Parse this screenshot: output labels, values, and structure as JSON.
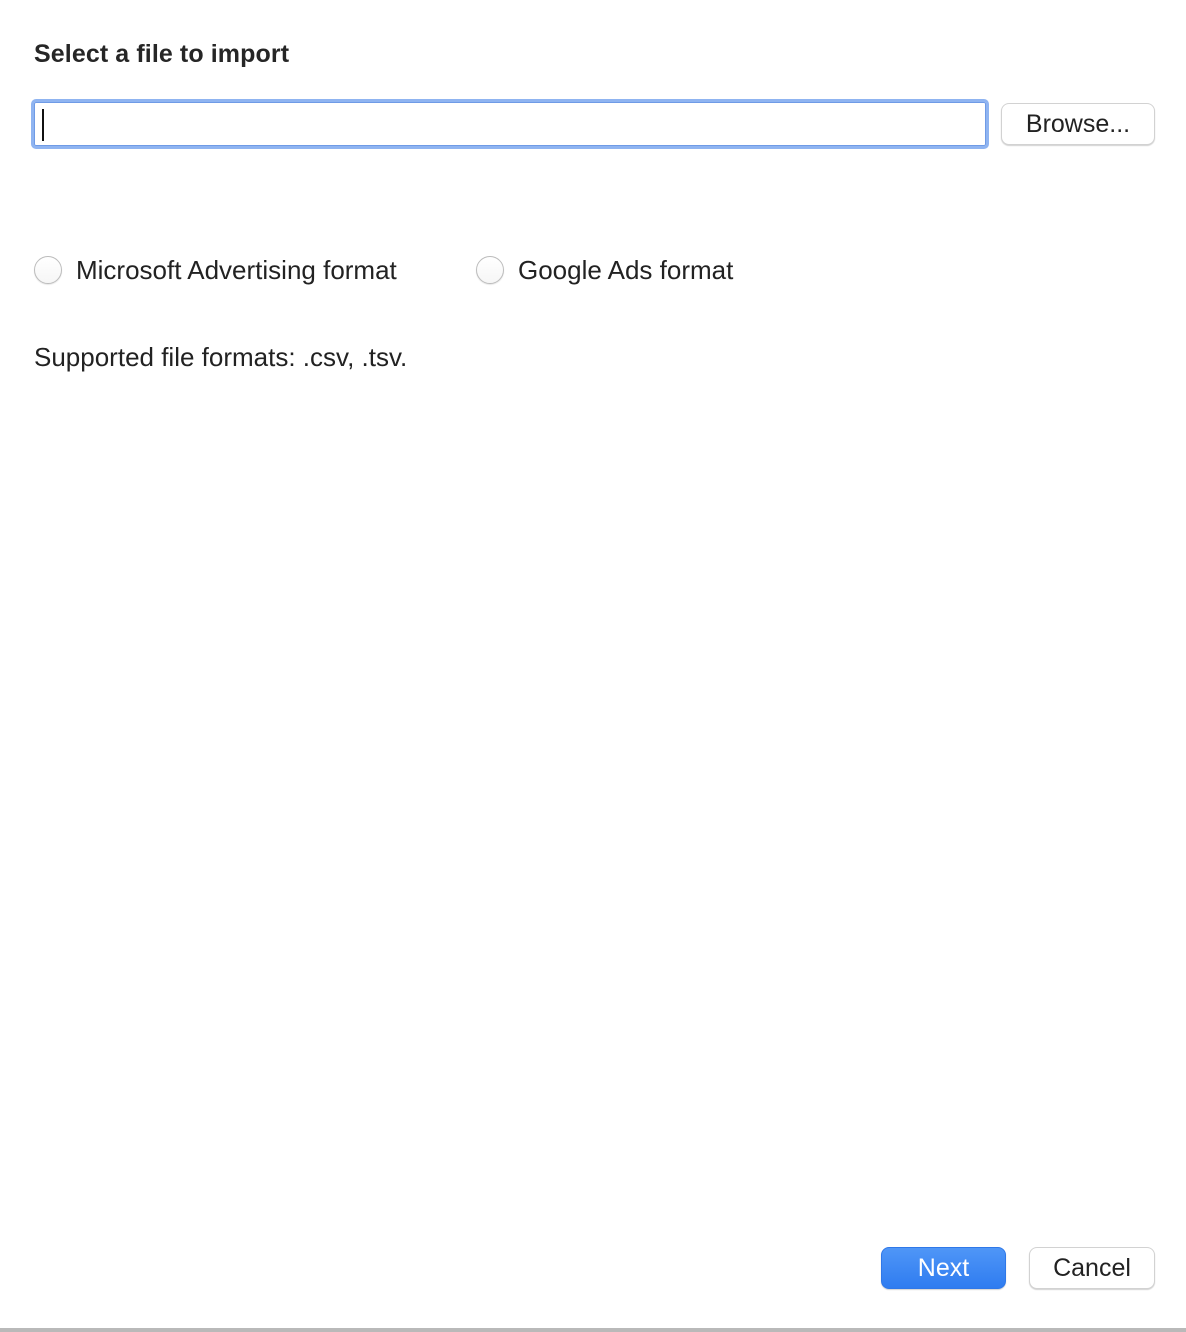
{
  "dialog": {
    "title": "Select a file to import",
    "file_input": {
      "value": "",
      "placeholder": ""
    },
    "browse_label": "Browse...",
    "format_options": [
      {
        "label": "Microsoft Advertising format",
        "selected": false
      },
      {
        "label": "Google Ads format",
        "selected": false
      }
    ],
    "supported_formats_text": "Supported file formats: .csv, .tsv.",
    "next_label": "Next",
    "cancel_label": "Cancel"
  },
  "colors": {
    "accent": "#2f7cf0",
    "focus_ring": "#8fb4f1",
    "text": "#222222"
  }
}
